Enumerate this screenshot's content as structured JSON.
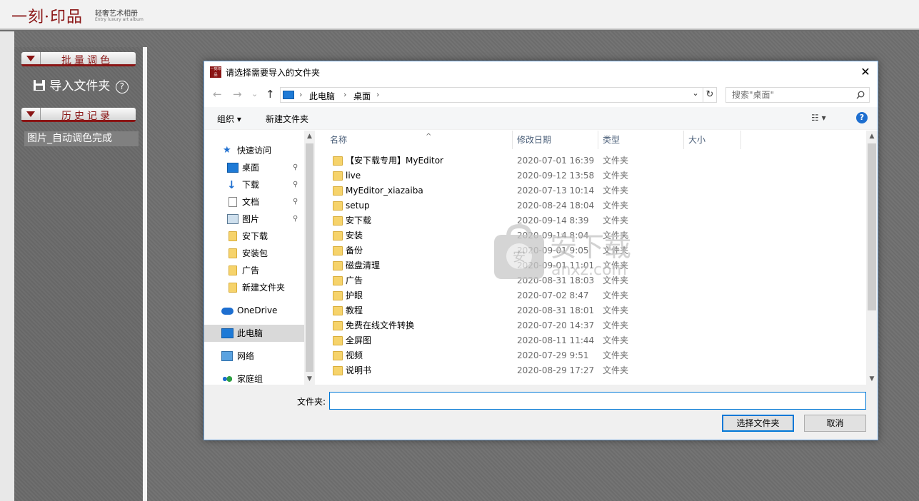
{
  "app": {
    "logo_text": "一刻·印品",
    "logo_subtitle": "轻奢艺术相册",
    "logo_subtitle_en": "Entry luxury art album",
    "brand_color": "#8a1515"
  },
  "left_panel": {
    "batch_section": "批量调色",
    "import_label": "导入文件夹",
    "help_glyph": "?",
    "history_section": "历史记录",
    "history_items": [
      "图片_自动调色完成"
    ]
  },
  "dialog": {
    "title": "请选择需要导入的文件夹",
    "app_icon_text": "一刻印品",
    "close_glyph": "✕",
    "nav": {
      "back": "←",
      "forward": "→",
      "recent": "⌄",
      "up": "↑"
    },
    "address": {
      "crumbs": [
        "此电脑",
        "桌面"
      ],
      "chevron": "›",
      "dropdown": "⌄",
      "refresh": "↻"
    },
    "search": {
      "placeholder": "搜索\"桌面\""
    },
    "toolbar": {
      "organize": "组织 ▾",
      "new_folder": "新建文件夹",
      "view": "☷ ▾",
      "help": "?"
    },
    "nav_pane": {
      "items": [
        {
          "label": "快速访问",
          "icon": "star-icon",
          "pinned": false
        },
        {
          "label": "桌面",
          "icon": "desktop-icon",
          "pinned": true
        },
        {
          "label": "下载",
          "icon": "download-icon",
          "pinned": true
        },
        {
          "label": "文档",
          "icon": "document-icon",
          "pinned": true
        },
        {
          "label": "图片",
          "icon": "pictures-icon",
          "pinned": true
        },
        {
          "label": "安下载",
          "icon": "folder-icon",
          "pinned": false
        },
        {
          "label": "安装包",
          "icon": "folder-icon",
          "pinned": false
        },
        {
          "label": "广告",
          "icon": "folder-icon",
          "pinned": false
        },
        {
          "label": "新建文件夹",
          "icon": "folder-icon",
          "pinned": false
        },
        {
          "label": "OneDrive",
          "icon": "cloud-icon",
          "pinned": false
        },
        {
          "label": "此电脑",
          "icon": "computer-icon",
          "pinned": false
        },
        {
          "label": "网络",
          "icon": "network-icon",
          "pinned": false
        },
        {
          "label": "家庭组",
          "icon": "homegroup-icon",
          "pinned": false
        }
      ],
      "pin_glyph": "📌",
      "scroll_up": "▲",
      "scroll_down": "▼"
    },
    "columns": [
      "名称",
      "修改日期",
      "类型",
      "大小"
    ],
    "sort_caret": "^",
    "files": [
      {
        "name": "【安下载专用】MyEditor",
        "date": "2020-07-01 16:39",
        "type": "文件夹"
      },
      {
        "name": "live",
        "date": "2020-09-12 13:58",
        "type": "文件夹"
      },
      {
        "name": "MyEditor_xiazaiba",
        "date": "2020-07-13 10:14",
        "type": "文件夹"
      },
      {
        "name": "setup",
        "date": "2020-08-24 18:04",
        "type": "文件夹"
      },
      {
        "name": "安下载",
        "date": "2020-09-14 8:39",
        "type": "文件夹"
      },
      {
        "name": "安装",
        "date": "2020-09-14 8:04",
        "type": "文件夹"
      },
      {
        "name": "备份",
        "date": "2020-09-01 9:05",
        "type": "文件夹"
      },
      {
        "name": "磁盘清理",
        "date": "2020-09-01 11:01",
        "type": "文件夹"
      },
      {
        "name": "广告",
        "date": "2020-08-31 18:03",
        "type": "文件夹"
      },
      {
        "name": "护眼",
        "date": "2020-07-02 8:47",
        "type": "文件夹"
      },
      {
        "name": "教程",
        "date": "2020-08-31 18:01",
        "type": "文件夹"
      },
      {
        "name": "免费在线文件转换",
        "date": "2020-07-20 14:37",
        "type": "文件夹"
      },
      {
        "name": "全屏图",
        "date": "2020-08-11 11:44",
        "type": "文件夹"
      },
      {
        "name": "视频",
        "date": "2020-07-29 9:51",
        "type": "文件夹"
      },
      {
        "name": "说明书",
        "date": "2020-08-29 17:27",
        "type": "文件夹"
      }
    ],
    "bottom": {
      "folder_label": "文件夹:",
      "folder_value": "",
      "select_button": "选择文件夹",
      "cancel_button": "取消"
    },
    "watermark": {
      "text": "安下载",
      "sub": "anxz.com",
      "shield_char": "安"
    }
  }
}
